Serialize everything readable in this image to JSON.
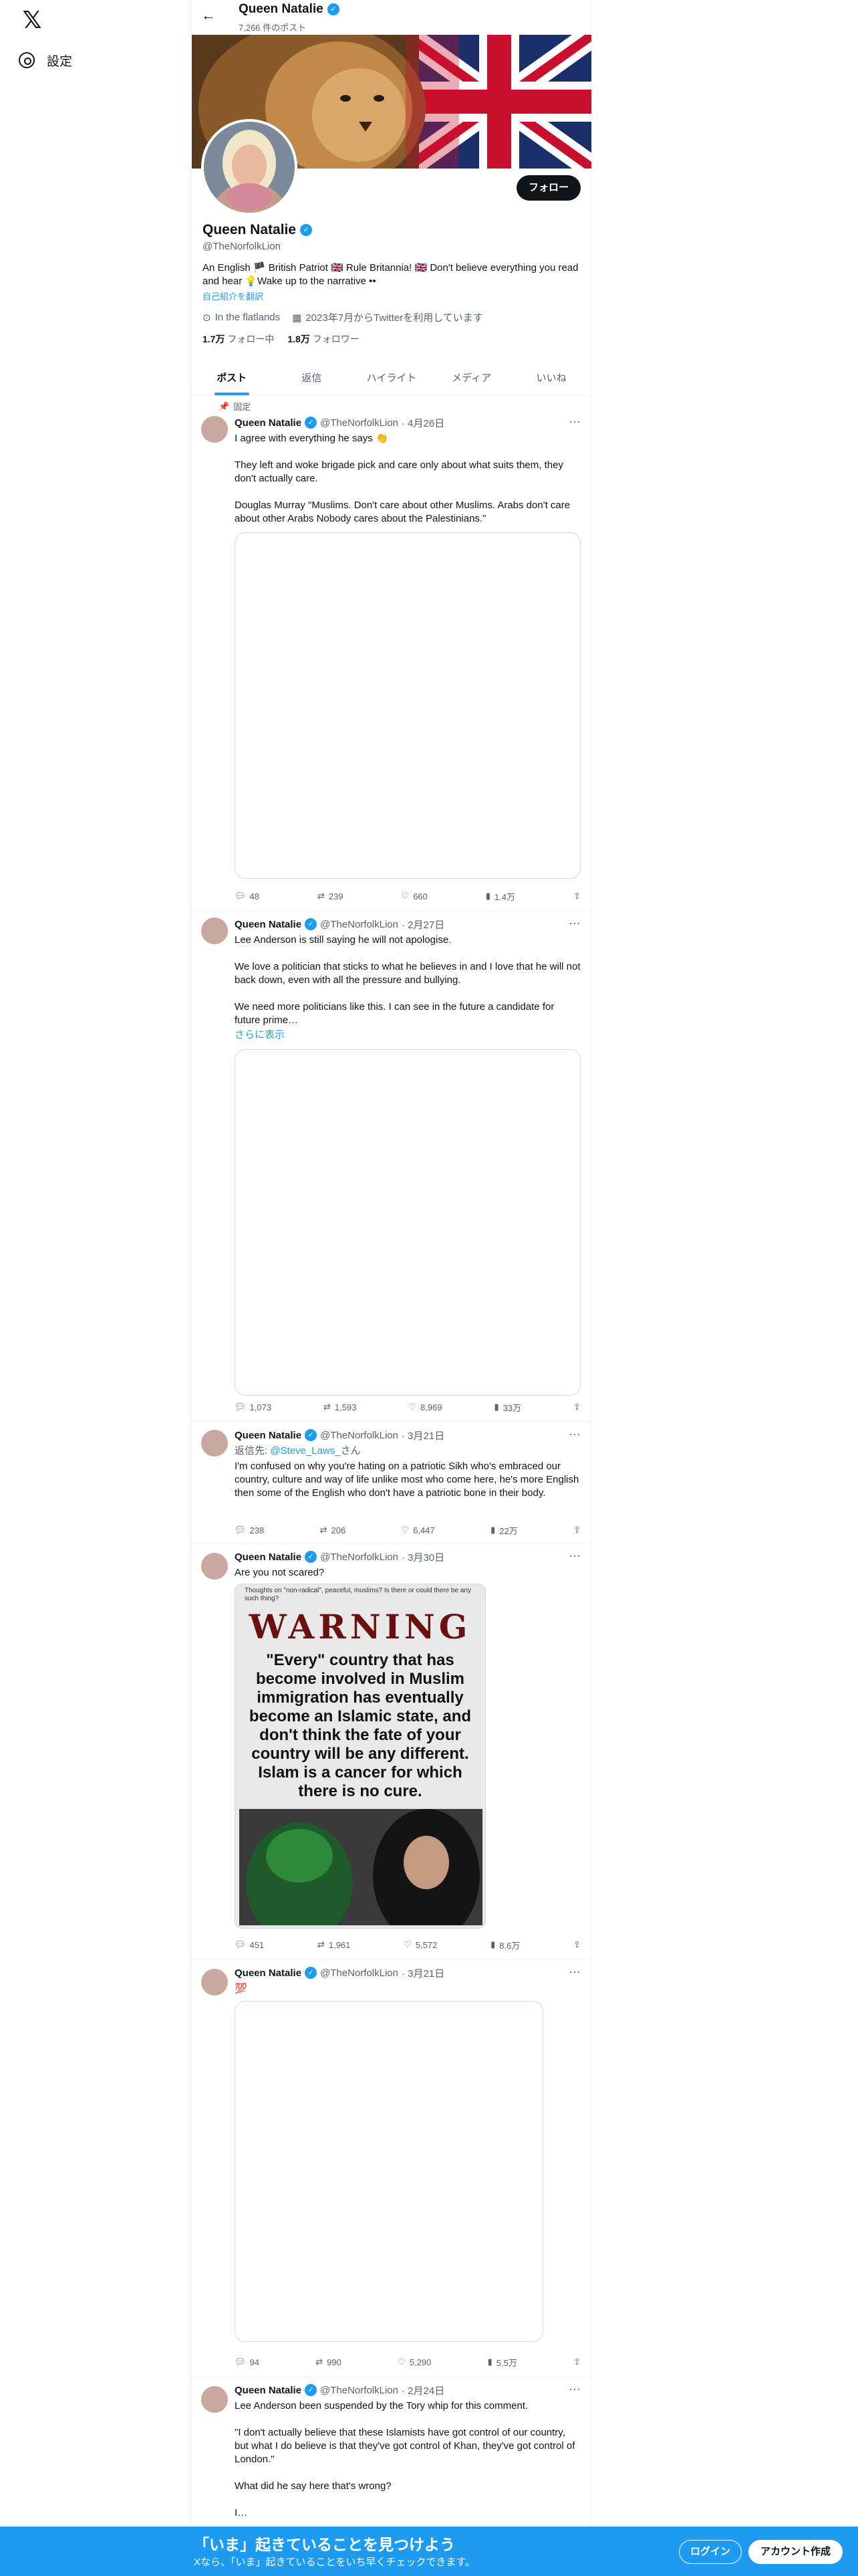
{
  "sidebar": {
    "logo": "𝕏",
    "settings_label": "設定"
  },
  "topbar": {
    "name": "Queen Natalie",
    "post_count": "7,266 件のポスト"
  },
  "profile": {
    "name": "Queen Natalie",
    "handle": "@TheNorfolkLion",
    "follow_label": "フォロー",
    "bio": "An English 🏴 British Patriot 🇬🇧 Rule Britannia! 🇬🇧 Don't believe everything you read and hear 💡Wake up to the narrative ••",
    "translate": "自己紹介を翻訳",
    "location": "In the flatlands",
    "joined": "2023年7月からTwitterを利用しています",
    "following_count": "1.7万",
    "following_label": "フォロー中",
    "followers_count": "1.8万",
    "followers_label": "フォロワー"
  },
  "tabs": [
    "ポスト",
    "返信",
    "ハイライト",
    "メディア",
    "いいね"
  ],
  "pinned_label": "固定",
  "tweets": [
    {
      "name": "Queen Natalie",
      "handle": "@TheNorfolkLion",
      "date": "· 4月26日",
      "text": "I agree with everything he says 👏\n\nThey left and woke brigade pick and care only about what suits them, they don't actually care.\n\nDouglas Murray \"Muslims. Don't care about other Muslims. Arabs don't care about other Arabs Nobody cares about the Palestinians.\"",
      "replies": "48",
      "reposts": "239",
      "likes": "660",
      "views": "1.4万"
    },
    {
      "name": "Queen Natalie",
      "handle": "@TheNorfolkLion",
      "date": "· 2月27日",
      "text": "Lee Anderson is still saying he will not apologise.\n\nWe love a politician that sticks to what he believes in and I love that he will not back down, even with all the pressure and bullying.\n\nWe need more politicians like this. I can see in the future a candidate for future prime…",
      "show_more": "さらに表示",
      "replies": "1,073",
      "reposts": "1,593",
      "likes": "8,969",
      "views": "33万"
    },
    {
      "name": "Queen Natalie",
      "handle": "@TheNorfolkLion",
      "date": "· 3月21日",
      "reply_prefix": "返信先: ",
      "reply_to": "@Steve_Laws_",
      "reply_suffix": "さん",
      "text": "I'm confused on why you're hating on a patriotic Sikh who's embraced our country, culture and way of life unlike most who come here, he's more English then some of the English who don't have a patriotic bone in their body.",
      "replies": "238",
      "reposts": "206",
      "likes": "6,447",
      "views": "22万"
    },
    {
      "name": "Queen Natalie",
      "handle": "@TheNorfolkLion",
      "date": "· 3月30日",
      "text": "Are you not scared?",
      "image_caption": "Thoughts on \"non-radical\", peaceful, muslims? Is there or could there be any such thing?",
      "image_title": "WARNING",
      "image_body": "\"Every\" country that has become involved in Muslim immigration has eventually become an Islamic state, and don't think the fate of your country will be any different. Islam is a cancer for which there is no cure.",
      "replies": "451",
      "reposts": "1,961",
      "likes": "5,572",
      "views": "8.6万"
    },
    {
      "name": "Queen Natalie",
      "handle": "@TheNorfolkLion",
      "date": "· 3月21日",
      "text": "💯",
      "replies": "94",
      "reposts": "990",
      "likes": "5,290",
      "views": "5.5万"
    },
    {
      "name": "Queen Natalie",
      "handle": "@TheNorfolkLion",
      "date": "· 2月24日",
      "text": "Lee Anderson been suspended by the Tory whip for this comment.\n\n\"I don't actually believe that these Islamists have got control of our country, but what I do believe is that they've got control of Khan, they've got control of London.\"\n\nWhat did he say here that's wrong?\n\nI…"
    }
  ],
  "login_bar": {
    "title": "「いま」起きていることを見つけよう",
    "subtitle": "Xなら、「いま」起きていることをいち早くチェックできます。",
    "login": "ログイン",
    "signup": "アカウント作成"
  },
  "colors": {
    "accent": "#1d9bf0",
    "text": "#0f1419",
    "muted": "#536471"
  }
}
